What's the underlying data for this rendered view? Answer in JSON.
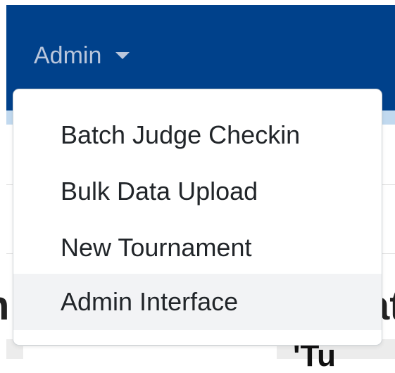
{
  "navbar": {
    "admin_label": "Admin",
    "colors": {
      "background": "#00418b",
      "text": "#b9c6dc"
    }
  },
  "dropdown": {
    "items": [
      {
        "label": "Batch Judge Checkin",
        "hovered": false
      },
      {
        "label": "Bulk Data Upload",
        "hovered": false
      },
      {
        "label": "New Tournament",
        "hovered": false
      },
      {
        "label": "Admin Interface",
        "hovered": true
      }
    ]
  },
  "background_page": {
    "left_fragment": "n",
    "right_fragment": "at",
    "bottom_fragment": "'Tu"
  }
}
